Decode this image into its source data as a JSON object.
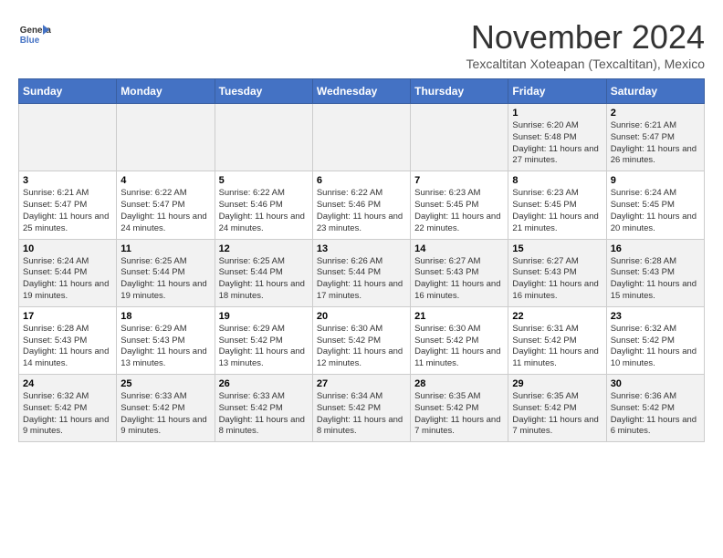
{
  "header": {
    "logo_line1": "General",
    "logo_line2": "Blue",
    "month_title": "November 2024",
    "subtitle": "Texcaltitan Xoteapan (Texcaltitan), Mexico"
  },
  "weekdays": [
    "Sunday",
    "Monday",
    "Tuesday",
    "Wednesday",
    "Thursday",
    "Friday",
    "Saturday"
  ],
  "weeks": [
    [
      {
        "day": "",
        "info": ""
      },
      {
        "day": "",
        "info": ""
      },
      {
        "day": "",
        "info": ""
      },
      {
        "day": "",
        "info": ""
      },
      {
        "day": "",
        "info": ""
      },
      {
        "day": "1",
        "info": "Sunrise: 6:20 AM\nSunset: 5:48 PM\nDaylight: 11 hours and 27 minutes."
      },
      {
        "day": "2",
        "info": "Sunrise: 6:21 AM\nSunset: 5:47 PM\nDaylight: 11 hours and 26 minutes."
      }
    ],
    [
      {
        "day": "3",
        "info": "Sunrise: 6:21 AM\nSunset: 5:47 PM\nDaylight: 11 hours and 25 minutes."
      },
      {
        "day": "4",
        "info": "Sunrise: 6:22 AM\nSunset: 5:47 PM\nDaylight: 11 hours and 24 minutes."
      },
      {
        "day": "5",
        "info": "Sunrise: 6:22 AM\nSunset: 5:46 PM\nDaylight: 11 hours and 24 minutes."
      },
      {
        "day": "6",
        "info": "Sunrise: 6:22 AM\nSunset: 5:46 PM\nDaylight: 11 hours and 23 minutes."
      },
      {
        "day": "7",
        "info": "Sunrise: 6:23 AM\nSunset: 5:45 PM\nDaylight: 11 hours and 22 minutes."
      },
      {
        "day": "8",
        "info": "Sunrise: 6:23 AM\nSunset: 5:45 PM\nDaylight: 11 hours and 21 minutes."
      },
      {
        "day": "9",
        "info": "Sunrise: 6:24 AM\nSunset: 5:45 PM\nDaylight: 11 hours and 20 minutes."
      }
    ],
    [
      {
        "day": "10",
        "info": "Sunrise: 6:24 AM\nSunset: 5:44 PM\nDaylight: 11 hours and 19 minutes."
      },
      {
        "day": "11",
        "info": "Sunrise: 6:25 AM\nSunset: 5:44 PM\nDaylight: 11 hours and 19 minutes."
      },
      {
        "day": "12",
        "info": "Sunrise: 6:25 AM\nSunset: 5:44 PM\nDaylight: 11 hours and 18 minutes."
      },
      {
        "day": "13",
        "info": "Sunrise: 6:26 AM\nSunset: 5:44 PM\nDaylight: 11 hours and 17 minutes."
      },
      {
        "day": "14",
        "info": "Sunrise: 6:27 AM\nSunset: 5:43 PM\nDaylight: 11 hours and 16 minutes."
      },
      {
        "day": "15",
        "info": "Sunrise: 6:27 AM\nSunset: 5:43 PM\nDaylight: 11 hours and 16 minutes."
      },
      {
        "day": "16",
        "info": "Sunrise: 6:28 AM\nSunset: 5:43 PM\nDaylight: 11 hours and 15 minutes."
      }
    ],
    [
      {
        "day": "17",
        "info": "Sunrise: 6:28 AM\nSunset: 5:43 PM\nDaylight: 11 hours and 14 minutes."
      },
      {
        "day": "18",
        "info": "Sunrise: 6:29 AM\nSunset: 5:43 PM\nDaylight: 11 hours and 13 minutes."
      },
      {
        "day": "19",
        "info": "Sunrise: 6:29 AM\nSunset: 5:42 PM\nDaylight: 11 hours and 13 minutes."
      },
      {
        "day": "20",
        "info": "Sunrise: 6:30 AM\nSunset: 5:42 PM\nDaylight: 11 hours and 12 minutes."
      },
      {
        "day": "21",
        "info": "Sunrise: 6:30 AM\nSunset: 5:42 PM\nDaylight: 11 hours and 11 minutes."
      },
      {
        "day": "22",
        "info": "Sunrise: 6:31 AM\nSunset: 5:42 PM\nDaylight: 11 hours and 11 minutes."
      },
      {
        "day": "23",
        "info": "Sunrise: 6:32 AM\nSunset: 5:42 PM\nDaylight: 11 hours and 10 minutes."
      }
    ],
    [
      {
        "day": "24",
        "info": "Sunrise: 6:32 AM\nSunset: 5:42 PM\nDaylight: 11 hours and 9 minutes."
      },
      {
        "day": "25",
        "info": "Sunrise: 6:33 AM\nSunset: 5:42 PM\nDaylight: 11 hours and 9 minutes."
      },
      {
        "day": "26",
        "info": "Sunrise: 6:33 AM\nSunset: 5:42 PM\nDaylight: 11 hours and 8 minutes."
      },
      {
        "day": "27",
        "info": "Sunrise: 6:34 AM\nSunset: 5:42 PM\nDaylight: 11 hours and 8 minutes."
      },
      {
        "day": "28",
        "info": "Sunrise: 6:35 AM\nSunset: 5:42 PM\nDaylight: 11 hours and 7 minutes."
      },
      {
        "day": "29",
        "info": "Sunrise: 6:35 AM\nSunset: 5:42 PM\nDaylight: 11 hours and 7 minutes."
      },
      {
        "day": "30",
        "info": "Sunrise: 6:36 AM\nSunset: 5:42 PM\nDaylight: 11 hours and 6 minutes."
      }
    ]
  ]
}
